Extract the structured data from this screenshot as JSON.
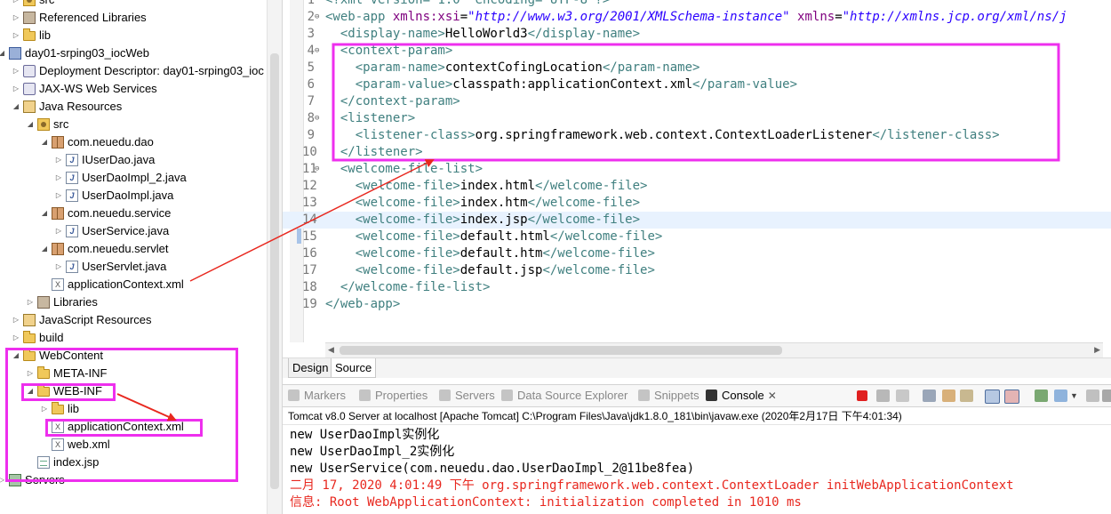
{
  "explorer": {
    "items": [
      {
        "label": "src",
        "icon": "src-folder-icon",
        "twisty": "▷"
      },
      {
        "label": "Referenced Libraries",
        "icon": "library-icon",
        "twisty": "▷"
      },
      {
        "label": "lib",
        "icon": "folder-icon",
        "twisty": "▷"
      },
      {
        "label": "day01-srping03_iocWeb",
        "icon": "web-project-icon",
        "twisty": "◢"
      },
      {
        "label": "Deployment Descriptor: day01-srping03_ioc",
        "icon": "deployment-descriptor-icon",
        "twisty": "▷"
      },
      {
        "label": "JAX-WS Web Services",
        "icon": "web-services-icon",
        "twisty": "▷"
      },
      {
        "label": "Java Resources",
        "icon": "java-resources-icon",
        "twisty": "◢"
      },
      {
        "label": "src",
        "icon": "src-folder-icon",
        "twisty": "◢"
      },
      {
        "label": "com.neuedu.dao",
        "icon": "package-icon",
        "twisty": "◢"
      },
      {
        "label": "IUserDao.java",
        "icon": "java-file-icon",
        "twisty": "▷"
      },
      {
        "label": "UserDaoImpl_2.java",
        "icon": "java-file-icon",
        "twisty": "▷"
      },
      {
        "label": "UserDaoImpl.java",
        "icon": "java-file-icon",
        "twisty": "▷"
      },
      {
        "label": "com.neuedu.service",
        "icon": "package-icon",
        "twisty": "◢"
      },
      {
        "label": "UserService.java",
        "icon": "java-file-icon",
        "twisty": "▷"
      },
      {
        "label": "com.neuedu.servlet",
        "icon": "package-icon",
        "twisty": "◢"
      },
      {
        "label": "UserServlet.java",
        "icon": "java-file-icon",
        "twisty": "▷"
      },
      {
        "label": "applicationContext.xml",
        "icon": "xml-file-icon",
        "twisty": ""
      },
      {
        "label": "Libraries",
        "icon": "library-icon",
        "twisty": "▷"
      },
      {
        "label": "JavaScript Resources",
        "icon": "javascript-resources-icon",
        "twisty": "▷"
      },
      {
        "label": "build",
        "icon": "folder-icon",
        "twisty": "▷"
      },
      {
        "label": "WebContent",
        "icon": "folder-icon",
        "twisty": "◢"
      },
      {
        "label": "META-INF",
        "icon": "folder-icon",
        "twisty": "▷"
      },
      {
        "label": "WEB-INF",
        "icon": "folder-icon",
        "twisty": "◢"
      },
      {
        "label": "lib",
        "icon": "folder-icon",
        "twisty": "▷"
      },
      {
        "label": "applicationContext.xml",
        "icon": "xml-file-icon",
        "twisty": ""
      },
      {
        "label": "web.xml",
        "icon": "xml-file-icon",
        "twisty": ""
      },
      {
        "label": "index.jsp",
        "icon": "jsp-file-icon",
        "twisty": ""
      },
      {
        "label": "Servers",
        "icon": "servers-icon",
        "twisty": "▷"
      }
    ]
  },
  "editor": {
    "lines": [
      {
        "n": "1",
        "fold": "",
        "segs": [
          [
            "t",
            "<?xml version=\"1.0\" encoding=\"UTF-8\"?>"
          ]
        ]
      },
      {
        "n": "2",
        "fold": "⊖",
        "segs": [
          [
            "t",
            "<web-app "
          ],
          [
            "a",
            "xmlns:xsi"
          ],
          [
            "txt",
            "="
          ],
          [
            "v",
            "\"http://www.w3.org/2001/XMLSchema-instance\""
          ],
          [
            "txt",
            " "
          ],
          [
            "a",
            "xmlns"
          ],
          [
            "txt",
            "="
          ],
          [
            "v",
            "\"http://xmlns.jcp.org/xml/ns/j"
          ]
        ]
      },
      {
        "n": "3",
        "fold": "",
        "segs": [
          [
            "t",
            "  <display-name>"
          ],
          [
            "txt",
            "HelloWorld3"
          ],
          [
            "t",
            "</display-name>"
          ]
        ]
      },
      {
        "n": "4",
        "fold": "⊖",
        "segs": [
          [
            "t",
            "  <context-param>"
          ]
        ]
      },
      {
        "n": "5",
        "fold": "",
        "segs": [
          [
            "t",
            "    <param-name>"
          ],
          [
            "txt",
            "contextCofingLocation"
          ],
          [
            "t",
            "</param-name>"
          ]
        ]
      },
      {
        "n": "6",
        "fold": "",
        "segs": [
          [
            "t",
            "    <param-value>"
          ],
          [
            "txt",
            "classpath:applicationContext.xml"
          ],
          [
            "t",
            "</param-value>"
          ]
        ]
      },
      {
        "n": "7",
        "fold": "",
        "segs": [
          [
            "t",
            "  </context-param>"
          ]
        ]
      },
      {
        "n": "8",
        "fold": "⊖",
        "segs": [
          [
            "t",
            "  <listener>"
          ]
        ]
      },
      {
        "n": "9",
        "fold": "",
        "segs": [
          [
            "t",
            "    <listener-class>"
          ],
          [
            "txt",
            "org.springframework.web.context.ContextLoaderListener"
          ],
          [
            "t",
            "</listener-class>"
          ]
        ]
      },
      {
        "n": "10",
        "fold": "",
        "segs": [
          [
            "t",
            "  </listener>"
          ]
        ]
      },
      {
        "n": "11",
        "fold": "⊖",
        "segs": [
          [
            "t",
            "  <welcome-file-list>"
          ]
        ]
      },
      {
        "n": "12",
        "fold": "",
        "segs": [
          [
            "t",
            "    <welcome-file>"
          ],
          [
            "txt",
            "index.html"
          ],
          [
            "t",
            "</welcome-file>"
          ]
        ]
      },
      {
        "n": "13",
        "fold": "",
        "segs": [
          [
            "t",
            "    <welcome-file>"
          ],
          [
            "txt",
            "index.htm"
          ],
          [
            "t",
            "</welcome-file>"
          ]
        ]
      },
      {
        "n": "14",
        "fold": "",
        "active": true,
        "segs": [
          [
            "t",
            "    <welcome-file>"
          ],
          [
            "txt",
            "index.jsp"
          ],
          [
            "t",
            "</welcome-file>"
          ]
        ]
      },
      {
        "n": "15",
        "fold": "",
        "segs": [
          [
            "t",
            "    <welcome-file>"
          ],
          [
            "txt",
            "default.html"
          ],
          [
            "t",
            "</welcome-file>"
          ]
        ]
      },
      {
        "n": "16",
        "fold": "",
        "segs": [
          [
            "t",
            "    <welcome-file>"
          ],
          [
            "txt",
            "default.htm"
          ],
          [
            "t",
            "</welcome-file>"
          ]
        ]
      },
      {
        "n": "17",
        "fold": "",
        "segs": [
          [
            "t",
            "    <welcome-file>"
          ],
          [
            "txt",
            "default.jsp"
          ],
          [
            "t",
            "</welcome-file>"
          ]
        ]
      },
      {
        "n": "18",
        "fold": "",
        "segs": [
          [
            "t",
            "  </welcome-file-list>"
          ]
        ]
      },
      {
        "n": "19",
        "fold": "",
        "segs": [
          [
            "t",
            "</web-app>"
          ]
        ]
      }
    ]
  },
  "editor_tabs": {
    "design": "Design",
    "source": "Source"
  },
  "console_tabs": [
    {
      "label": "Markers",
      "icon": "markers-icon"
    },
    {
      "label": "Properties",
      "icon": "properties-icon"
    },
    {
      "label": "Servers",
      "icon": "servers-icon"
    },
    {
      "label": "Data Source Explorer",
      "icon": "data-source-explorer-icon"
    },
    {
      "label": "Snippets",
      "icon": "snippets-icon"
    },
    {
      "label": "Console",
      "icon": "console-icon",
      "active": true,
      "close": "✕"
    }
  ],
  "console": {
    "header": "Tomcat v8.0 Server at localhost [Apache Tomcat] C:\\Program Files\\Java\\jdk1.8.0_181\\bin\\javaw.exe (2020年2月17日 下午4:01:34)",
    "lines": [
      {
        "text": "new UserDaoImpl实例化",
        "kind": "out"
      },
      {
        "text": "new UserDaoImpl_2实例化",
        "kind": "out"
      },
      {
        "text": "new UserService(com.neuedu.dao.UserDaoImpl_2@11be8fea)",
        "kind": "out"
      },
      {
        "text": "二月 17, 2020 4:01:49 下午 org.springframework.web.context.ContextLoader initWebApplicationContext",
        "kind": "err"
      },
      {
        "text": "信息: Root WebApplicationContext: initialization completed in 1010 ms",
        "kind": "err"
      }
    ]
  },
  "colors": {
    "annotation": "#ee2fee",
    "arrow": "#e8281f",
    "xml_tag": "#3f7f7f",
    "xml_attr": "#7f007f",
    "xml_value": "#2a00ff",
    "console_error": "#e8281f"
  }
}
